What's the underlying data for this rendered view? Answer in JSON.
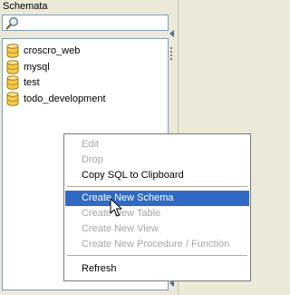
{
  "panel": {
    "title": "Schemata",
    "search": {
      "placeholder": "",
      "value": ""
    }
  },
  "schemas": [
    {
      "name": "croscro_web",
      "icon": "database-icon"
    },
    {
      "name": "mysql",
      "icon": "database-icon"
    },
    {
      "name": "test",
      "icon": "database-icon"
    },
    {
      "name": "todo_development",
      "icon": "database-icon"
    }
  ],
  "context_menu": {
    "items": [
      {
        "label": "Edit",
        "enabled": false
      },
      {
        "label": "Drop",
        "enabled": false
      },
      {
        "label": "Copy SQL to Clipboard",
        "enabled": true
      },
      {
        "label": "Create New Schema",
        "enabled": true,
        "highlighted": true
      },
      {
        "label": "Create New Table",
        "enabled": false
      },
      {
        "label": "Create New View",
        "enabled": false
      },
      {
        "label": "Create New Procedure / Function",
        "enabled": false
      },
      {
        "label": "Refresh",
        "enabled": true
      }
    ]
  },
  "colors": {
    "highlight": "#316ac5",
    "disabled_text": "#a7a6aa",
    "panel_bg": "#ece9d8",
    "border": "#7f9db9"
  }
}
